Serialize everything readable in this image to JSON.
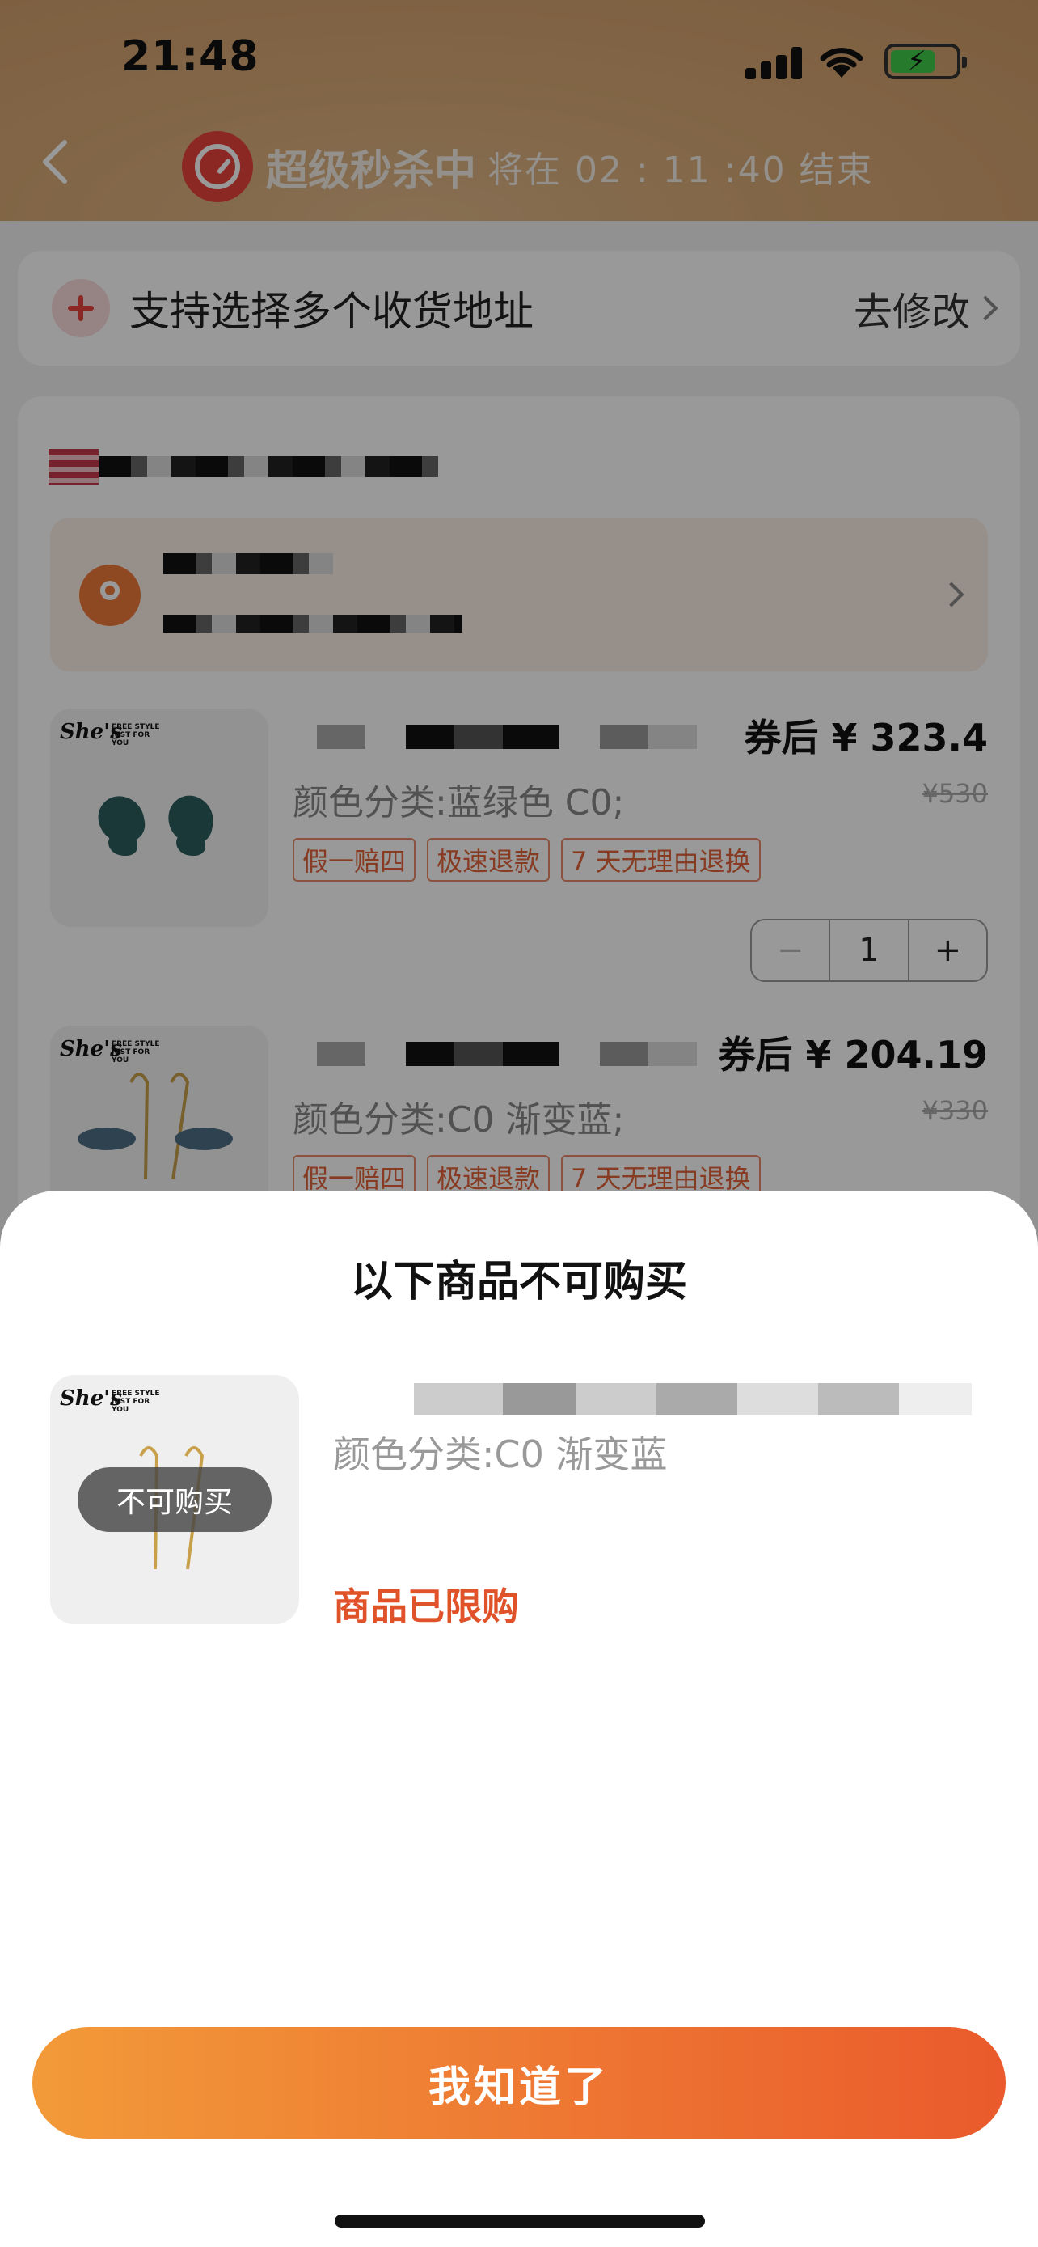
{
  "status_bar": {
    "time": "21:48"
  },
  "header": {
    "flash_sale_label": "超级秒杀中",
    "countdown_text": "将在 02 : 11 :40 结束"
  },
  "address_bar": {
    "label": "支持选择多个收货地址",
    "edit_label": "去修改"
  },
  "items": [
    {
      "brand": "She's",
      "brand_tagline": "FREE STYLE JUST FOR YOU",
      "spec": "颜色分类:蓝绿色 C0;",
      "price": "券后 ¥ 323.4",
      "original_price": "¥530",
      "tags": [
        "假一赔四",
        "极速退款",
        "7 天无理由退换"
      ],
      "quantity": "1"
    },
    {
      "brand": "She's",
      "brand_tagline": "FREE STYLE JUST FOR YOU",
      "spec": "颜色分类:C0 渐变蓝;",
      "price": "券后 ¥ 204.19",
      "original_price": "¥330",
      "tags": [
        "假一赔四",
        "极速退款",
        "7 天无理由退换"
      ]
    }
  ],
  "sheet": {
    "title": "以下商品不可购买",
    "badge": "不可购买",
    "brand": "She's",
    "brand_tagline": "FREE STYLE JUST FOR YOU",
    "spec": "颜色分类:C0 渐变蓝",
    "reason": "商品已限购",
    "confirm_label": "我知道了"
  },
  "colors": {
    "accent": "#e0532a",
    "button_gradient_start": "#f29a39",
    "button_gradient_end": "#ea5a2c",
    "header_bg": "#d9ab78"
  },
  "icons": [
    "back-icon",
    "clock-icon",
    "signal-icon",
    "wifi-icon",
    "battery-icon",
    "plus-icon",
    "chevron-right-icon",
    "location-icon"
  ]
}
